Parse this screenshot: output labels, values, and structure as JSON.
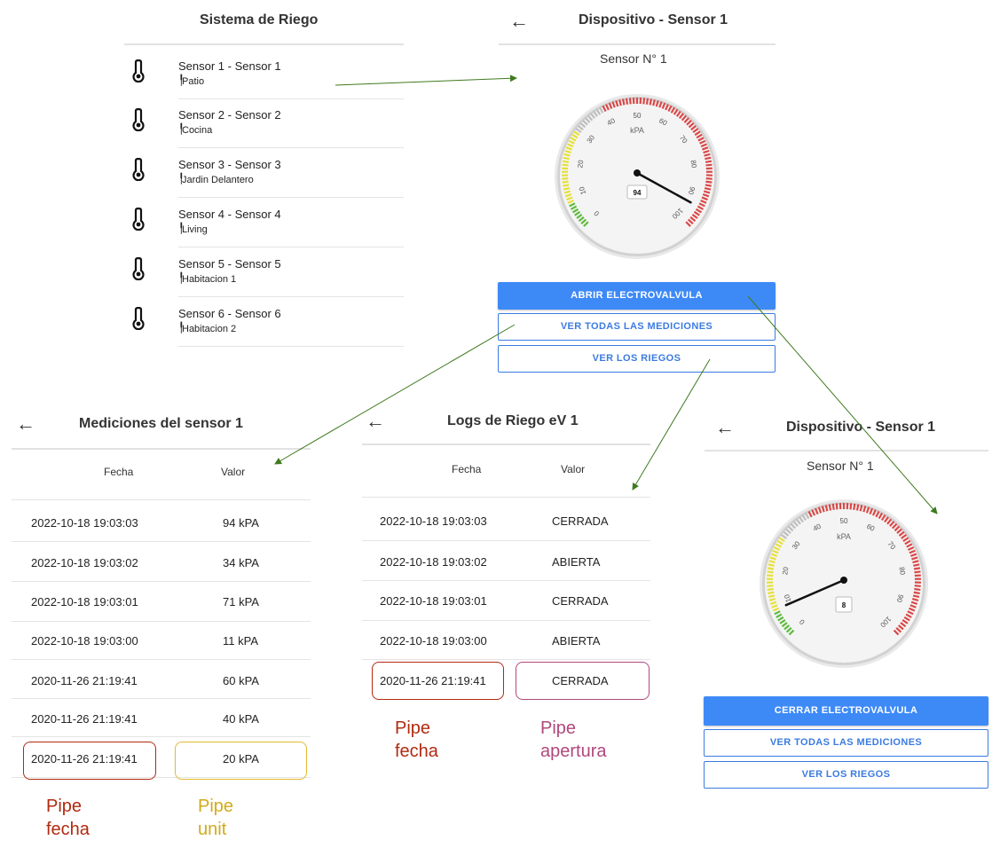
{
  "sensor_list": {
    "title": "Sistema de Riego",
    "items": [
      {
        "name": "Sensor 1 - Sensor 1",
        "location": "Patio"
      },
      {
        "name": "Sensor 2 - Sensor 2",
        "location": "Cocina"
      },
      {
        "name": "Sensor 3 - Sensor 3",
        "location": "Jardin Delantero"
      },
      {
        "name": "Sensor 4 - Sensor 4",
        "location": "Living"
      },
      {
        "name": "Sensor 5 - Sensor 5",
        "location": "Habitacion 1"
      },
      {
        "name": "Sensor 6 - Sensor 6",
        "location": "Habitacion 2"
      }
    ]
  },
  "device_top": {
    "back": "←",
    "title": "Dispositivo - Sensor 1",
    "subtitle": "Sensor N° 1",
    "gauge_unit": "kPA",
    "gauge_value": 94,
    "gauge_ticks": [
      "0",
      "10",
      "20",
      "30",
      "40",
      "50",
      "60",
      "70",
      "80",
      "90",
      "100"
    ],
    "btn_valve": "ABRIR ELECTROVALVULA",
    "btn_measurements": "VER TODAS LAS MEDICIONES",
    "btn_irrigations": "VER LOS RIEGOS"
  },
  "device_bottom": {
    "back": "←",
    "title": "Dispositivo - Sensor 1",
    "subtitle": "Sensor N° 1",
    "gauge_unit": "kPA",
    "gauge_value": 8,
    "gauge_ticks": [
      "0",
      "10",
      "20",
      "30",
      "40",
      "50",
      "60",
      "70",
      "80",
      "90",
      "100"
    ],
    "btn_valve": "CERRAR ELECTROVALVULA",
    "btn_measurements": "VER TODAS LAS MEDICIONES",
    "btn_irrigations": "VER LOS RIEGOS"
  },
  "measurements": {
    "back": "←",
    "title": "Mediciones del sensor 1",
    "col_date": "Fecha",
    "col_value": "Valor",
    "rows": [
      {
        "date": "2022-10-18 19:03:03",
        "value": "94 kPA"
      },
      {
        "date": "2022-10-18 19:03:02",
        "value": "34 kPA"
      },
      {
        "date": "2022-10-18 19:03:01",
        "value": "71 kPA"
      },
      {
        "date": "2022-10-18 19:03:00",
        "value": "11 kPA"
      },
      {
        "date": "2020-11-26 21:19:41",
        "value": "60 kPA"
      },
      {
        "date": "2020-11-26 21:19:41",
        "value": "40 kPA"
      },
      {
        "date": "2020-11-26 21:19:41",
        "value": "20 kPA"
      }
    ]
  },
  "logs": {
    "back": "←",
    "title": "Logs de Riego eV 1",
    "col_date": "Fecha",
    "col_value": "Valor",
    "rows": [
      {
        "date": "2022-10-18 19:03:03",
        "value": "CERRADA"
      },
      {
        "date": "2022-10-18 19:03:02",
        "value": "ABIERTA"
      },
      {
        "date": "2022-10-18 19:03:01",
        "value": "CERRADA"
      },
      {
        "date": "2022-10-18 19:03:00",
        "value": "ABIERTA"
      },
      {
        "date": "2020-11-26 21:19:41",
        "value": "CERRADA"
      }
    ]
  },
  "annotations": {
    "meas_date_pipe": [
      "Pipe",
      "fecha"
    ],
    "meas_unit_pipe": [
      "Pipe",
      "unit"
    ],
    "logs_date_pipe": [
      "Pipe",
      "fecha"
    ],
    "logs_open_pipe": [
      "Pipe",
      "apertura"
    ]
  },
  "colors": {
    "primary": "#3d8af7",
    "outline": "#3b7be0",
    "arrow": "#3f7a1f",
    "pipe_fecha": "#b02a10",
    "pipe_unit": "#d4a91a",
    "pipe_apertura": "#b0487c",
    "gauge_green": "#5dba3c",
    "gauge_yellow": "#e6e03a",
    "gauge_red": "#d94848"
  }
}
